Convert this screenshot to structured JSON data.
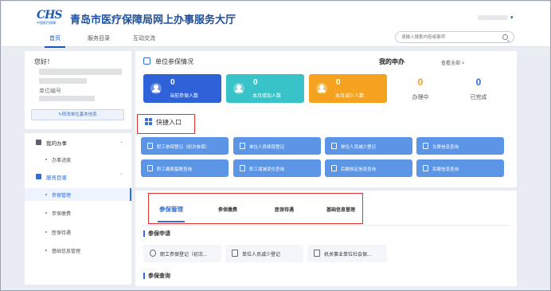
{
  "header": {
    "logo_mark": "CHS",
    "logo_sub": "中国医疗保障",
    "title": "青岛市医疗保障局网上办事服务大厅",
    "nav_tabs": [
      {
        "label": "首页",
        "active": true
      },
      {
        "label": "服务目录",
        "active": false
      },
      {
        "label": "互动交流",
        "active": false
      }
    ],
    "search_placeholder": "请输入搜索内容或事项"
  },
  "profile": {
    "greeting": "您好！",
    "unit_no_label": "单位编号",
    "edit_button": "✎修改单位基本信息"
  },
  "sidebar": {
    "groups": [
      {
        "label": "我的办事",
        "arrow": "⌄",
        "items": [
          {
            "label": "办事进度",
            "active": false
          }
        ]
      },
      {
        "label": "服务目录",
        "arrow": "⌃",
        "items": [
          {
            "label": "参保管理",
            "active": true
          },
          {
            "label": "参保缴费",
            "active": false
          },
          {
            "label": "医保待遇",
            "active": false
          },
          {
            "label": "基础信息管理",
            "active": false
          }
        ]
      }
    ]
  },
  "overview": {
    "title": "单位参保情况",
    "tiles": [
      {
        "value": "0",
        "label": "当前参保人数",
        "color": "#2f62d8"
      },
      {
        "value": "0",
        "label": "本月增加人数",
        "color": "#38c3c8"
      },
      {
        "value": "0",
        "label": "本月减少人数",
        "color": "#f4a21f"
      }
    ],
    "todo": {
      "title": "我的申办",
      "view_all": "查看全部 >",
      "stats": [
        {
          "value": "0",
          "label": "办理中"
        },
        {
          "value": "0",
          "label": "已完成"
        }
      ]
    }
  },
  "quick_entry": {
    "title": "快捷入口",
    "buttons": [
      "职工参保登记（初次参保）",
      "单位人员续保登记",
      "单位人员减少登记",
      "欠费信息查询",
      "职工缴费基数查询",
      "职工增减变化查询",
      "后缴核定信息查询",
      "实缴信息查询"
    ]
  },
  "service_tabs": {
    "tabs": [
      {
        "label": "参保管理",
        "active": true
      },
      {
        "label": "参保缴费",
        "active": false
      },
      {
        "label": "医保待遇",
        "active": false
      },
      {
        "label": "基础信息管理",
        "active": false
      }
    ],
    "enrollment_section": {
      "title": "参保申请",
      "items": [
        "职工参保登记（初次...",
        "单位人员减少登记",
        "机关事业单位社会保..."
      ]
    },
    "query_section": {
      "title": "参保查询"
    }
  }
}
